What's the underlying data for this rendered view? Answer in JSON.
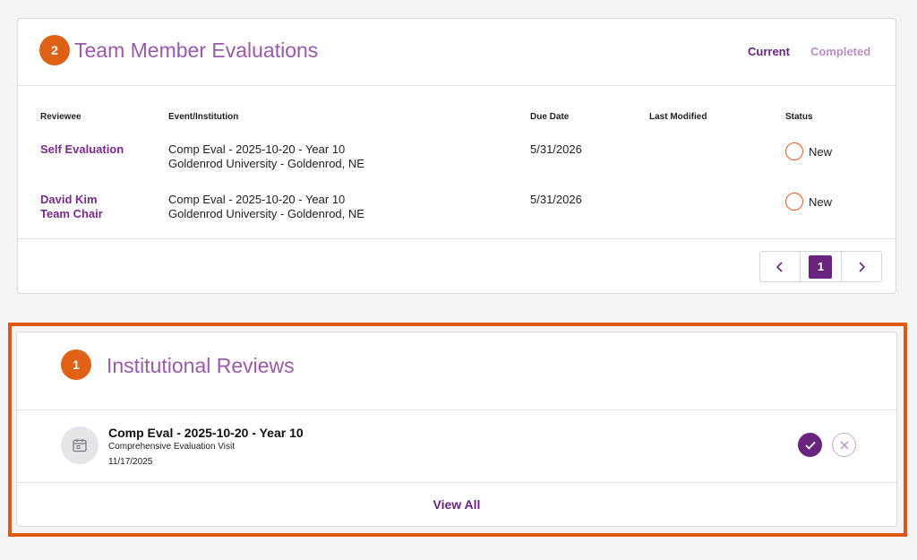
{
  "team_evaluations": {
    "count": "2",
    "title": "Team Member Evaluations",
    "tabs": {
      "current": "Current",
      "completed": "Completed"
    },
    "columns": {
      "reviewee": "Reviewee",
      "event": "Event/Institution",
      "due_date": "Due Date",
      "last_modified": "Last Modified",
      "status": "Status"
    },
    "rows": [
      {
        "reviewee_line1": "Self Evaluation",
        "reviewee_line2": "",
        "event": "Comp Eval - 2025-10-20 - Year 10",
        "institution": "Goldenrod University - Goldenrod, NE",
        "due_date": "5/31/2026",
        "last_modified": "",
        "status": "New"
      },
      {
        "reviewee_line1": "David Kim",
        "reviewee_line2": "Team Chair",
        "event": "Comp Eval - 2025-10-20 - Year 10",
        "institution": "Goldenrod University - Goldenrod, NE",
        "due_date": "5/31/2026",
        "last_modified": "",
        "status": "New"
      }
    ],
    "pagination": {
      "current_page": "1"
    }
  },
  "institutional_reviews": {
    "count": "1",
    "title": "Institutional Reviews",
    "item": {
      "title": "Comp Eval - 2025-10-20 - Year 10",
      "subtitle": "Comprehensive Evaluation Visit",
      "date": "11/17/2025",
      "icon": "calendar-icon"
    },
    "view_all": "View All"
  },
  "colors": {
    "accent_purple": "#6b2380",
    "badge_orange": "#e06116",
    "highlight_orange": "#e0570f"
  }
}
